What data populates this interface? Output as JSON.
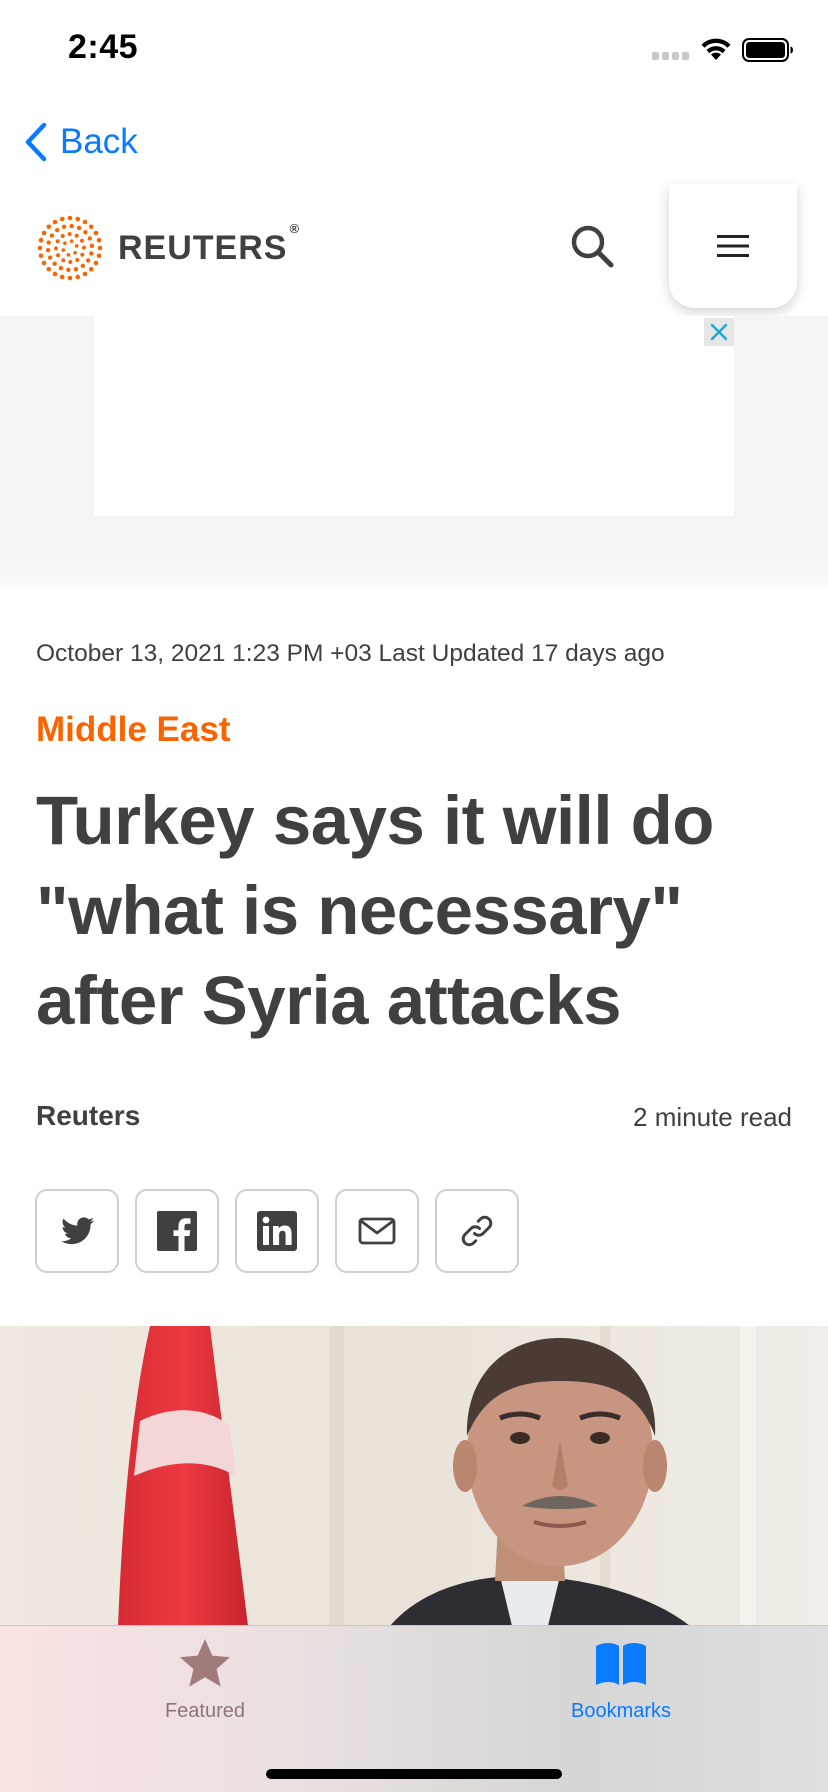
{
  "status_bar": {
    "time": "2:45"
  },
  "nav": {
    "back_label": "Back"
  },
  "header": {
    "brand": "REUTERS",
    "brand_mark": "®",
    "brand_color": "#fa6400"
  },
  "ad": {
    "close_icon": "close-icon"
  },
  "article": {
    "dateline": "October 13, 2021 1:23 PM +03 Last Updated 17 days ago",
    "section": "Middle East",
    "headline": "Turkey says it will do \"what is necessary\" after Syria attacks",
    "byline": "Reuters",
    "read_time": "2 minute read",
    "share_buttons": [
      "twitter-icon",
      "facebook-icon",
      "linkedin-icon",
      "mail-icon",
      "link-icon"
    ]
  },
  "tab_bar": {
    "tabs": [
      {
        "label": "Featured",
        "icon": "star-icon",
        "selected": false
      },
      {
        "label": "Bookmarks",
        "icon": "book-icon",
        "selected": true
      }
    ],
    "accent_color": "#0a7aff"
  }
}
